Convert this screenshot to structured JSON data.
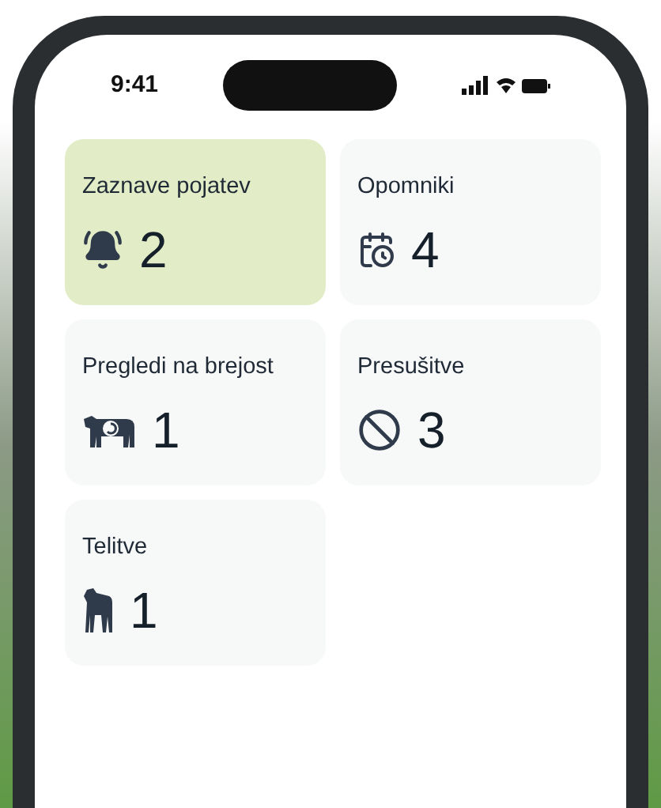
{
  "status_bar": {
    "time": "9:41"
  },
  "cards": [
    {
      "kind": "bell",
      "title": "Zaznave pojatev",
      "count": "2",
      "selected": true
    },
    {
      "kind": "calendar",
      "title": "Opomniki",
      "count": "4",
      "selected": false
    },
    {
      "kind": "cow",
      "title": "Pregledi na brejost",
      "count": "1",
      "selected": false
    },
    {
      "kind": "dry",
      "title": "Presušitve",
      "count": "3",
      "selected": false
    },
    {
      "kind": "calf",
      "title": "Telitve",
      "count": "1",
      "selected": false
    }
  ]
}
